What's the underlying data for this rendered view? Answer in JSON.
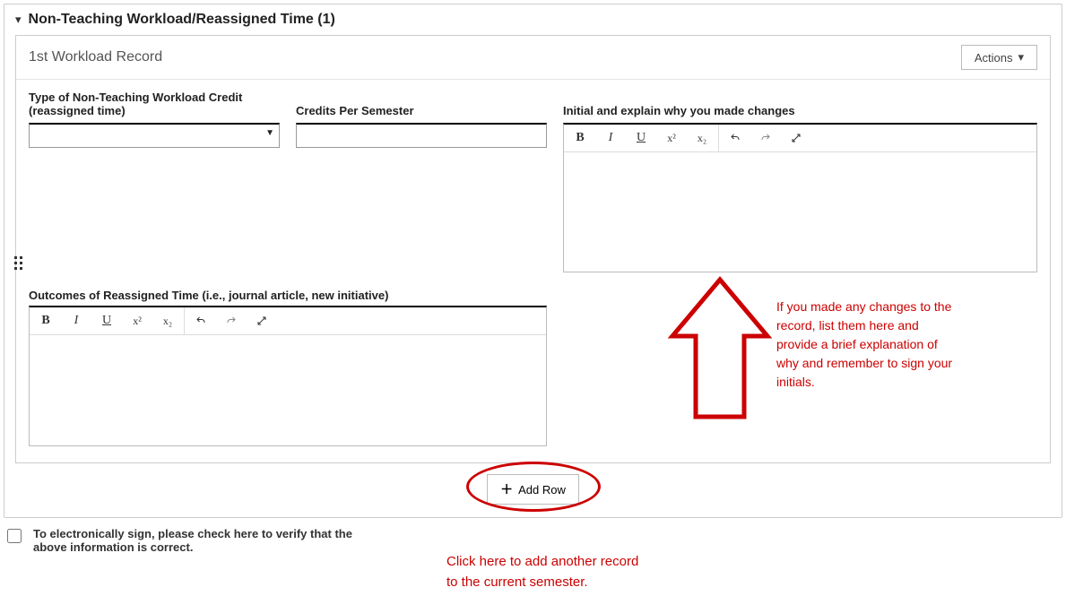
{
  "section": {
    "title": "Non-Teaching Workload/Reassigned Time (1)"
  },
  "record": {
    "title": "1st Workload Record",
    "actions_label": "Actions",
    "fields": {
      "type_label": "Type of Non-Teaching Workload Credit (reassigned time)",
      "type_value": "",
      "credits_label": "Credits Per Semester",
      "credits_value": "",
      "initial_label": "Initial and explain why you made changes",
      "initial_value": "",
      "outcomes_label": "Outcomes of Reassigned Time (i.e., journal article, new initiative)",
      "outcomes_value": ""
    }
  },
  "add_row_label": "Add Row",
  "esign_label": "To electronically sign, please check here to verify that the above information is correct.",
  "annotations": {
    "right_arrow_text": "If you made any changes to the record, list them here and provide a brief explanation of why and remember to sign your initials.",
    "bottom_text": "Click here to add another record to the current semester."
  },
  "toolbar_buttons": {
    "bold": "B",
    "italic": "I",
    "underline": "U",
    "superscript": "x²",
    "subscript": "x₂"
  }
}
